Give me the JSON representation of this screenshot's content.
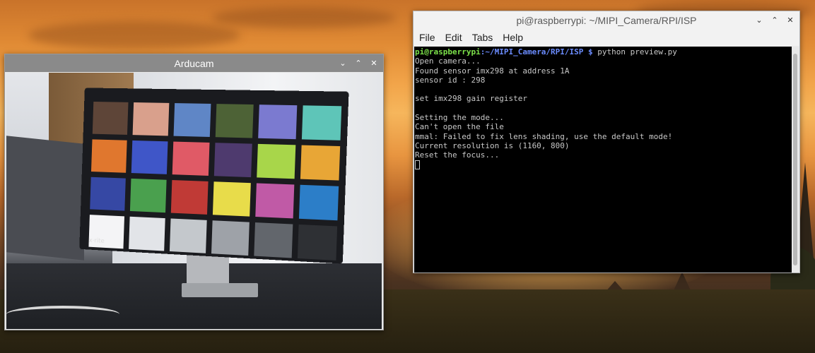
{
  "desktop": {
    "wallpaper": "sunset-temples"
  },
  "arducam_window": {
    "title": "Arducam",
    "controls": {
      "minimize_icon": "chevron-down-icon",
      "maximize_icon": "chevron-up-icon",
      "close_icon": "close-icon"
    },
    "colorchecker_patches": [
      "#5e4538",
      "#d9a08c",
      "#5f86c6",
      "#4d6236",
      "#7b7ad0",
      "#5ec5b8",
      "#e0772e",
      "#3f56c8",
      "#e05a66",
      "#4e3a6e",
      "#a8d64a",
      "#e8a636",
      "#3648a4",
      "#4aa04e",
      "#c03a36",
      "#e8dc4a",
      "#c05aa6",
      "#2c7ec8",
      "#f4f4f6",
      "#e2e4e8",
      "#c4c8cc",
      "#9ea2a8",
      "#62666c",
      "#2e3034"
    ],
    "brand_mark": "x·rite"
  },
  "terminal_window": {
    "title": "pi@raspberrypi: ~/MIPI_Camera/RPI/ISP",
    "menu": [
      "File",
      "Edit",
      "Tabs",
      "Help"
    ],
    "prompt_user": "pi@raspberrypi",
    "prompt_path": ":~/MIPI_Camera/RPI/ISP $",
    "command": " python preview.py",
    "output_lines": [
      "Open camera...",
      "Found sensor imx298 at address 1A",
      "sensor id : 298",
      "",
      "set imx298 gain register",
      "",
      "Setting the mode...",
      "Can't open the file",
      "mmal: Failed to fix lens shading, use the default mode!",
      "Current resolution is (1160, 800)",
      "Reset the focus..."
    ]
  }
}
